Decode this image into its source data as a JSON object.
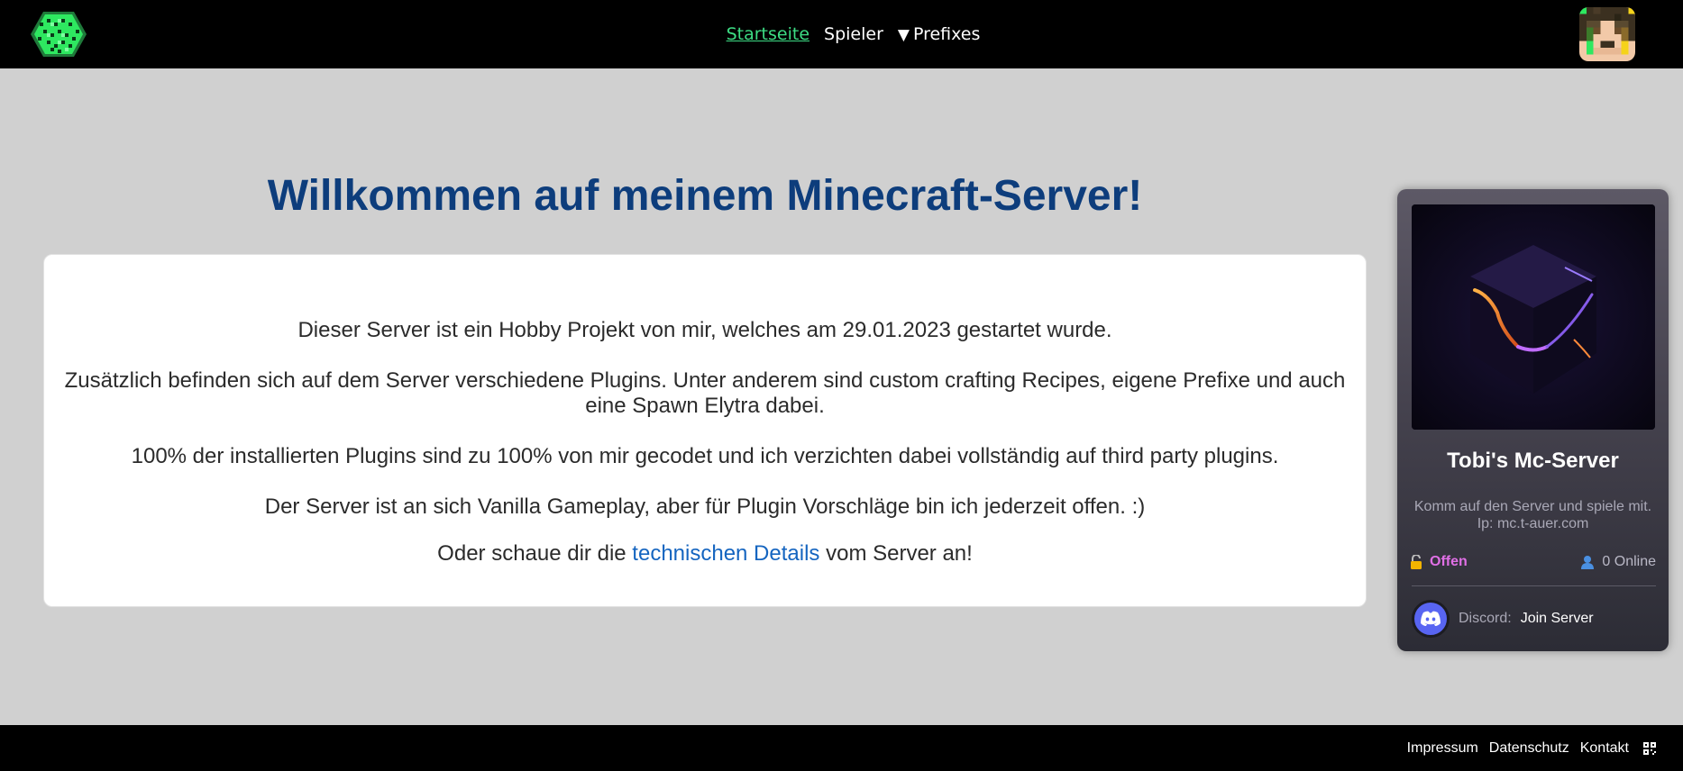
{
  "header": {
    "nav": {
      "home": "Startseite",
      "players": "Spieler",
      "prefixes_arrow": "▼",
      "prefixes": "Prefixes"
    },
    "accent_color": "#3ddc84"
  },
  "main": {
    "title": "Willkommen auf meinem Minecraft-Server!",
    "paragraphs": {
      "p1": "Dieser Server ist ein Hobby Projekt von mir, welches am 29.01.2023 gestartet wurde.",
      "p2": "Zusätzlich befinden sich auf dem Server verschiedene Plugins. Unter anderem sind custom crafting Recipes, eigene Prefixe und auch eine Spawn Elytra dabei.",
      "p3": "100% der installierten Plugins sind zu 100% von mir gecodet und ich verzichten dabei vollständig auf third party plugins.",
      "p4": "Der Server ist an sich Vanilla Gameplay, aber für Plugin Vorschläge bin ich jederzeit offen. :)"
    },
    "last": {
      "before": "Oder schaue dir die ",
      "link": "technischen Details",
      "after": " vom Server an!"
    },
    "title_color": "#0d3d7c",
    "link_color": "#1565c0"
  },
  "widget": {
    "server_name": "Tobi's Mc-Server",
    "motd_line1": "Komm auf den Server und spiele mit.",
    "motd_line2": "Ip: mc.t-auer.com",
    "status": "Offen",
    "online": "0 Online",
    "discord_label": "Discord:",
    "discord_link": "Join Server",
    "status_color": "#e070e6",
    "discord_color": "#5865f2"
  },
  "footer": {
    "impressum": "Impressum",
    "datenschutz": "Datenschutz",
    "kontakt": "Kontakt"
  }
}
